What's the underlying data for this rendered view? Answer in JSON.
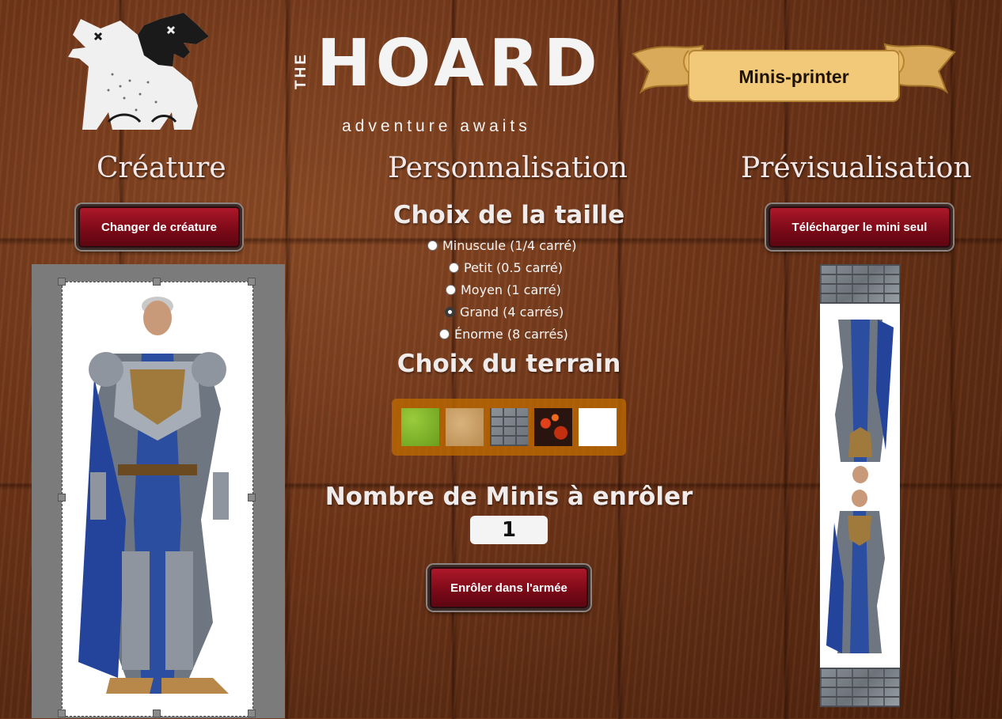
{
  "brand": {
    "the": "THE",
    "name": "HOARD",
    "tagline": "adventure awaits"
  },
  "nav": {
    "scroll_label": "Minis-printer"
  },
  "columns": {
    "creature": {
      "title": "Créature",
      "button": "Changer de créature"
    },
    "custom": {
      "title": "Personnalisation"
    },
    "preview": {
      "title": "Prévisualisation",
      "button": "Télécharger le mini seul"
    }
  },
  "size": {
    "title": "Choix de la taille",
    "options": [
      {
        "label": "Minuscule (1/4 carré)",
        "checked": false
      },
      {
        "label": "Petit (0.5 carré)",
        "checked": false
      },
      {
        "label": "Moyen (1 carré)",
        "checked": false
      },
      {
        "label": "Grand (4 carrés)",
        "checked": true
      },
      {
        "label": "Énorme (8 carrés)",
        "checked": false
      }
    ]
  },
  "terrain": {
    "title": "Choix du terrain",
    "tiles": [
      "grass",
      "sand",
      "stone",
      "lava",
      "white"
    ]
  },
  "enlist": {
    "title": "Nombre de Minis à enrôler",
    "count": "1",
    "button": "Enrôler dans l'armée"
  },
  "colors": {
    "button_red": "#8e0f1e",
    "accent_orange": "#c26c00",
    "text_light": "#f0ecec"
  }
}
